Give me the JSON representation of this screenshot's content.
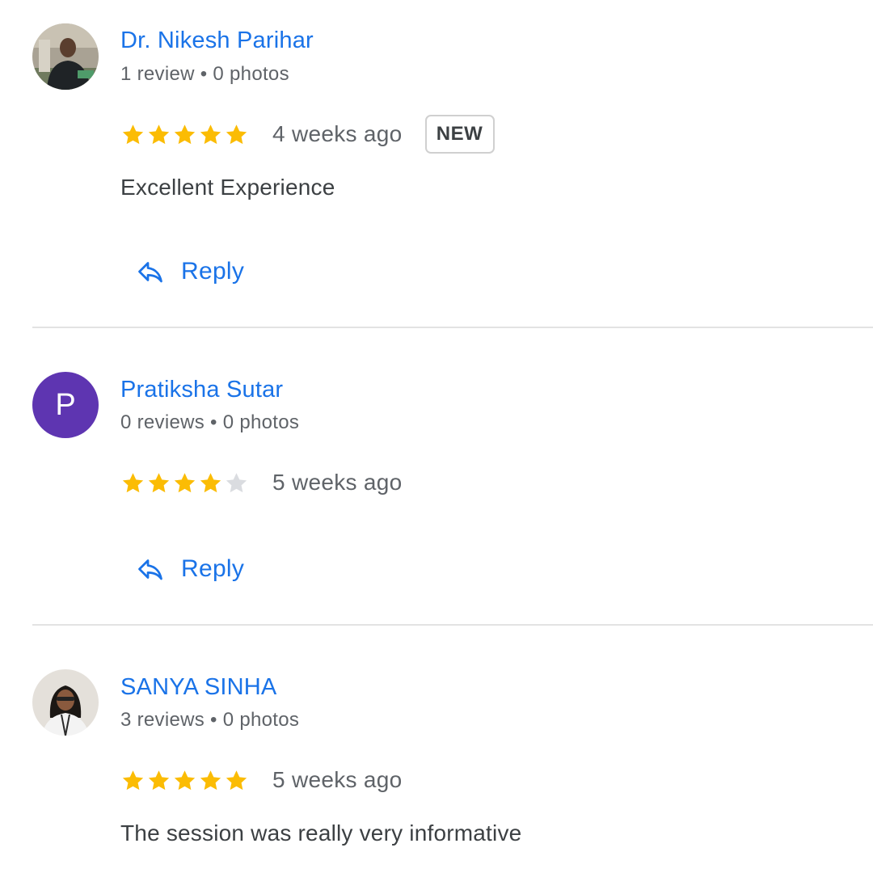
{
  "colors": {
    "link": "#1a73e8",
    "star_filled": "#fbbc04",
    "star_empty": "#dadce0",
    "avatar_letter_bg": "#5e35b1",
    "divider": "#e3e3e3"
  },
  "reviews": [
    {
      "name": "Dr. Nikesh Parihar",
      "stats": "1 review • 0 photos",
      "avatar_type": "photo",
      "rating": 5,
      "time": "4 weeks ago",
      "badge": "NEW",
      "text": "Excellent Experience",
      "reply_label": "Reply"
    },
    {
      "name": "Pratiksha Sutar",
      "stats": "0 reviews • 0 photos",
      "avatar_type": "letter",
      "avatar_letter": "P",
      "rating": 4,
      "time": "5 weeks ago",
      "reply_label": "Reply"
    },
    {
      "name": "SANYA SINHA",
      "stats": "3 reviews • 0 photos",
      "avatar_type": "photo",
      "rating": 5,
      "time": "5 weeks ago",
      "text": "The session was really very informative"
    }
  ]
}
